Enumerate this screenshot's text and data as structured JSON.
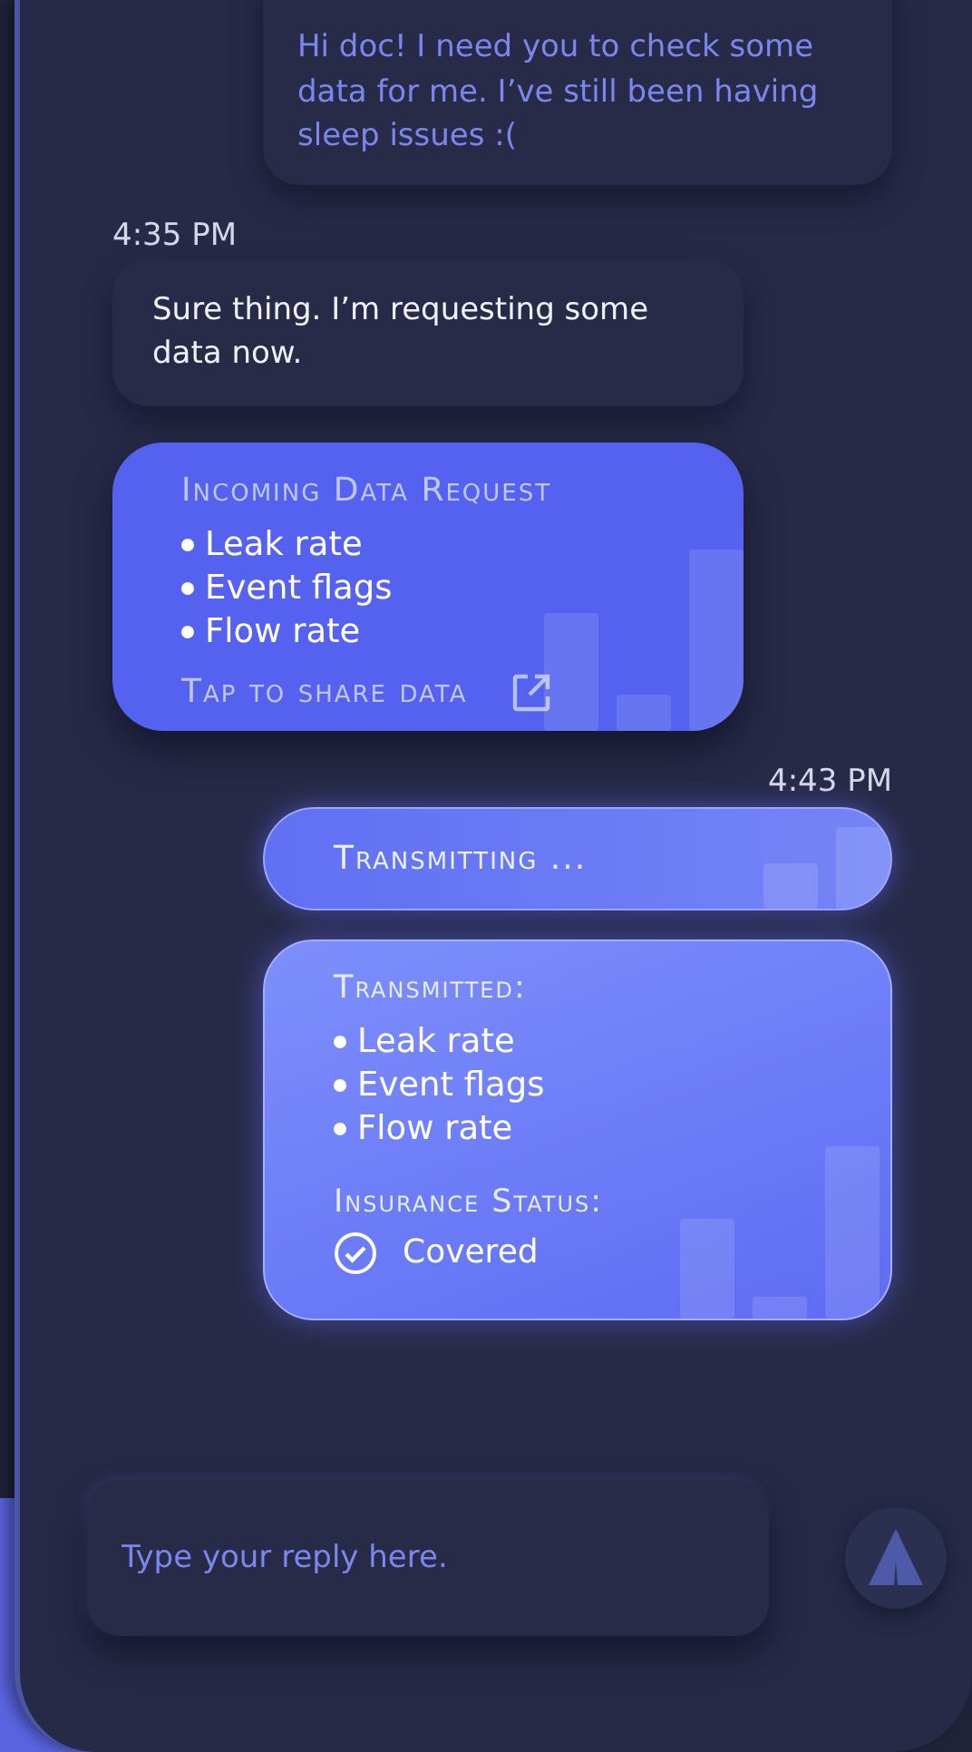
{
  "messages": [
    {
      "kind": "outgoing_text",
      "text": "Hi doc! I need you to check some data for me. I’ve still been having sleep issues :("
    },
    {
      "kind": "incoming_time",
      "text": "4:35 PM"
    },
    {
      "kind": "incoming_text",
      "text": "Sure thing. I’m requesting some data now."
    },
    {
      "kind": "request_card",
      "title": "Incoming Data Request",
      "items": [
        "Leak rate",
        "Event flags",
        "Flow rate"
      ],
      "action": "Tap to share data"
    },
    {
      "kind": "outgoing_time",
      "text": "4:43 PM"
    },
    {
      "kind": "status_pill",
      "text": "Transmitting ..."
    },
    {
      "kind": "transmitted_card",
      "title": "Transmitted:",
      "items": [
        "Leak rate",
        "Event flags",
        "Flow rate"
      ],
      "status_label": "Insurance Status:",
      "status": {
        "text": "Covered",
        "checked": true
      }
    }
  ],
  "reply": {
    "placeholder": "Type your reply here."
  }
}
